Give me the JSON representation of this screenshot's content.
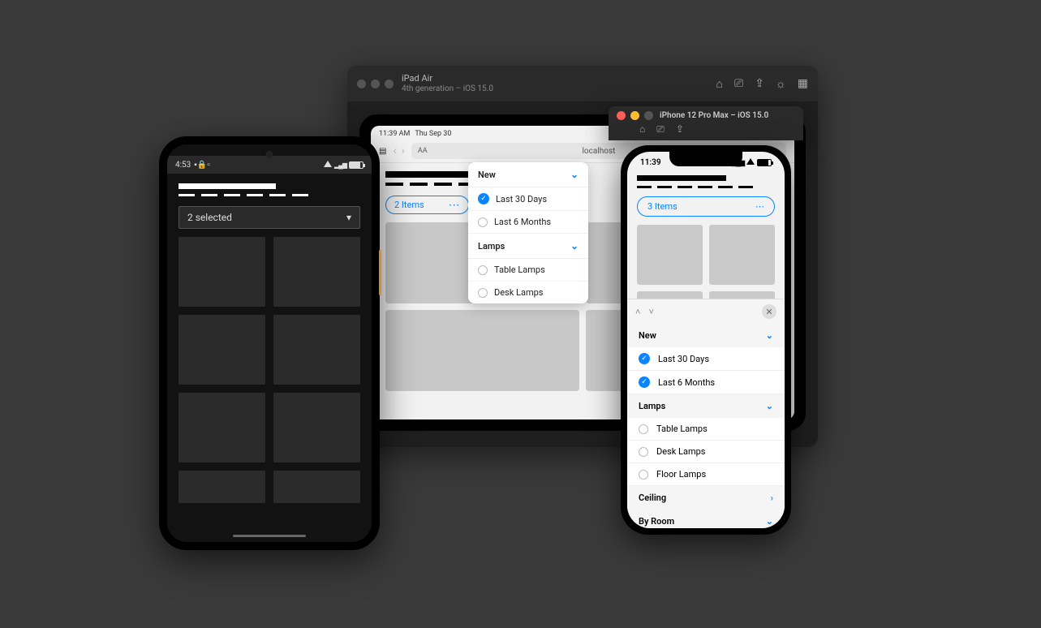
{
  "ipad_sim": {
    "title": "iPad Air",
    "subtitle": "4th generation – iOS 15.0"
  },
  "ipad": {
    "status_time": "11:39 AM",
    "status_date": "Thu Sep 30",
    "safari_aa": "AA",
    "safari_url": "localhost",
    "badge": "2 Items",
    "badge_more": "⋯",
    "popover": {
      "sections": [
        {
          "title": "New",
          "items": [
            {
              "label": "Last 30 Days",
              "checked": true
            },
            {
              "label": "Last 6 Months",
              "checked": false
            }
          ]
        },
        {
          "title": "Lamps",
          "items": [
            {
              "label": "Table Lamps",
              "checked": false
            },
            {
              "label": "Desk Lamps",
              "checked": false
            }
          ]
        }
      ]
    }
  },
  "iphone_sim": {
    "title": "iPhone 12 Pro Max – iOS 15.0"
  },
  "iphone": {
    "status_time": "11:39",
    "badge": "3 Items",
    "badge_more": "⋯",
    "sheet": {
      "sections": [
        {
          "title": "New",
          "expanded": true,
          "items": [
            {
              "label": "Last 30 Days",
              "checked": true
            },
            {
              "label": "Last 6 Months",
              "checked": true
            }
          ]
        },
        {
          "title": "Lamps",
          "expanded": true,
          "items": [
            {
              "label": "Table Lamps",
              "checked": false
            },
            {
              "label": "Desk Lamps",
              "checked": false
            },
            {
              "label": "Floor Lamps",
              "checked": false
            }
          ]
        },
        {
          "title": "Ceiling",
          "expanded": false,
          "items": []
        },
        {
          "title": "By Room",
          "expanded": false,
          "items": []
        }
      ]
    }
  },
  "android": {
    "status_time": "4:53",
    "select_label": "2 selected"
  }
}
